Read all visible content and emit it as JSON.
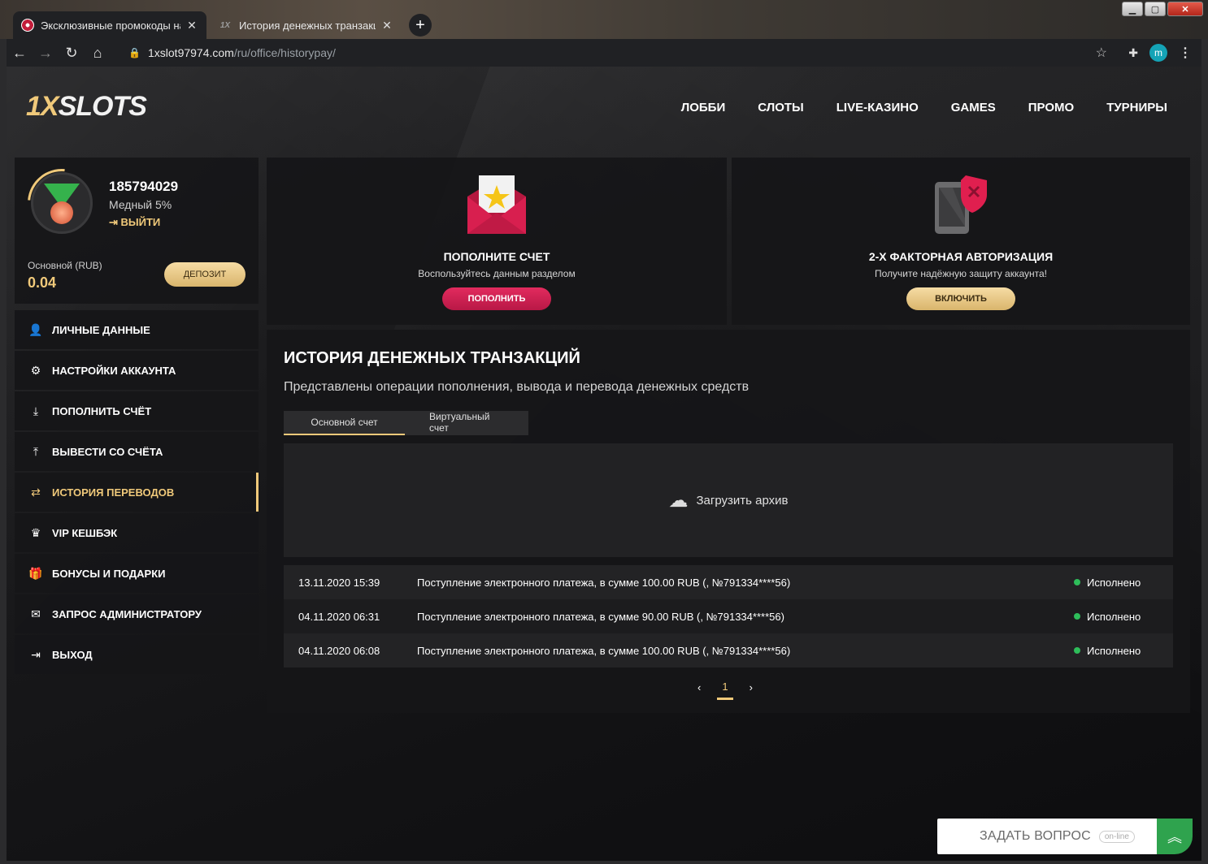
{
  "browser": {
    "tabs": [
      {
        "title": "Эксклюзивные промокоды на ф"
      },
      {
        "title": "История денежных транзакций"
      }
    ],
    "new_tab": "+",
    "url_host": "1xslot97974.com",
    "url_path": "/ru/office/historypay/",
    "profile_initial": "m",
    "icons": {
      "back": "arrow-left-icon",
      "forward": "arrow-right-icon",
      "reload": "reload-icon",
      "home": "home-icon",
      "lock": "lock-icon",
      "star": "star-icon",
      "extensions": "puzzle-icon",
      "menu": "more-vert-icon"
    }
  },
  "site": {
    "logo_one": "1X",
    "logo_rest": "SLOTS",
    "nav": [
      "ЛОББИ",
      "СЛОТЫ",
      "LIVE-КАЗИНО",
      "GAMES",
      "ПРОМО",
      "ТУРНИРЫ"
    ]
  },
  "profile": {
    "user_id": "185794029",
    "level": "Медный 5%",
    "logout": "ВЫЙТИ",
    "balance_label": "Основной (RUB)",
    "balance_value": "0.04",
    "deposit_label": "ДЕПОЗИТ"
  },
  "side_menu": [
    {
      "label": "ЛИЧНЫЕ ДАННЫЕ",
      "icon": "user-plus-icon",
      "glyph": "👤"
    },
    {
      "label": "НАСТРОЙКИ АККАУНТА",
      "icon": "gears-icon",
      "glyph": "⚙"
    },
    {
      "label": "ПОПОЛНИТЬ СЧЁТ",
      "icon": "download-icon",
      "glyph": "⤓"
    },
    {
      "label": "ВЫВЕСТИ СО СЧЁТА",
      "icon": "upload-icon",
      "glyph": "⤒"
    },
    {
      "label": "ИСТОРИЯ ПЕРЕВОДОВ",
      "icon": "exchange-icon",
      "glyph": "⇄",
      "active": true
    },
    {
      "label": "VIP КЕШБЭК",
      "icon": "crown-icon",
      "glyph": "♛"
    },
    {
      "label": "БОНУСЫ И ПОДАРКИ",
      "icon": "gift-icon",
      "glyph": "🎁"
    },
    {
      "label": "ЗАПРОС АДМИНИСТРАТОРУ",
      "icon": "envelope-icon",
      "glyph": "✉"
    },
    {
      "label": "ВЫХОД",
      "icon": "sign-out-icon",
      "glyph": "⇥"
    }
  ],
  "promo": {
    "deposit": {
      "title": "ПОПОЛНИТЕ СЧЕТ",
      "subtitle": "Воспользуйтесь данным разделом",
      "button": "ПОПОЛНИТЬ"
    },
    "twofa": {
      "title": "2-Х ФАКТОРНАЯ АВТОРИЗАЦИЯ",
      "subtitle": "Получите надёжную защиту аккаунта!",
      "button": "ВКЛЮЧИТЬ"
    }
  },
  "history": {
    "title": "ИСТОРИЯ ДЕНЕЖНЫХ ТРАНЗАКЦИЙ",
    "subtitle": "Представлены операции пополнения, вывода и перевода денежных средств",
    "tabs": [
      "Основной счет",
      "Виртуальный счет"
    ],
    "archive_label": "Загрузить архив",
    "rows": [
      {
        "date": "13.11.2020 15:39",
        "desc": "Поступление электронного платежа, в сумме 100.00 RUB (, №791334****56)",
        "status": "Исполнено"
      },
      {
        "date": "04.11.2020 06:31",
        "desc": "Поступление электронного платежа, в сумме 90.00 RUB (, №791334****56)",
        "status": "Исполнено"
      },
      {
        "date": "04.11.2020 06:08",
        "desc": "Поступление электронного платежа, в сумме 100.00 RUB (, №791334****56)",
        "status": "Исполнено"
      }
    ],
    "pager": {
      "prev": "‹",
      "current": "1",
      "next": "›"
    }
  },
  "chat": {
    "label": "ЗАДАТЬ ВОПРОС",
    "status": "on-line"
  },
  "colors": {
    "accent_gold": "#f0c97a",
    "accent_red": "#e22b5e",
    "status_green": "#2ebd5a",
    "chat_green": "#2fa34e"
  }
}
